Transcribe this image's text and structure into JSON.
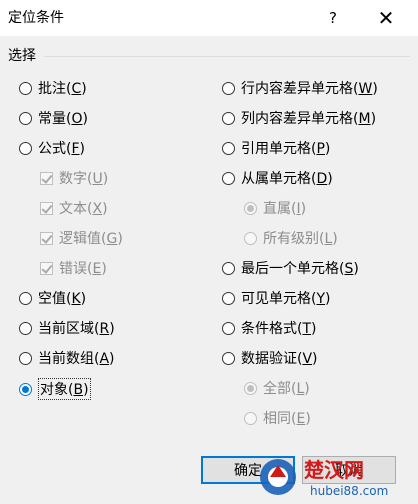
{
  "window": {
    "title": "定位条件",
    "help_label": "?",
    "close_label": "✕"
  },
  "group": {
    "label": "选择"
  },
  "left_options": [
    {
      "text": "批注",
      "key": "C"
    },
    {
      "text": "常量",
      "key": "O"
    },
    {
      "text": "公式",
      "key": "F"
    },
    {
      "text": "数字",
      "key": "U"
    },
    {
      "text": "文本",
      "key": "X"
    },
    {
      "text": "逻辑值",
      "key": "G"
    },
    {
      "text": "错误",
      "key": "E"
    },
    {
      "text": "空值",
      "key": "K"
    },
    {
      "text": "当前区域",
      "key": "R"
    },
    {
      "text": "当前数组",
      "key": "A"
    },
    {
      "text": "对象",
      "key": "B"
    }
  ],
  "right_options": [
    {
      "text": "行内容差异单元格",
      "key": "W"
    },
    {
      "text": "列内容差异单元格",
      "key": "M"
    },
    {
      "text": "引用单元格",
      "key": "P"
    },
    {
      "text": "从属单元格",
      "key": "D"
    },
    {
      "text": "直属",
      "key": "I"
    },
    {
      "text": "所有级别",
      "key": "L"
    },
    {
      "text": "最后一个单元格",
      "key": "S"
    },
    {
      "text": "可见单元格",
      "key": "Y"
    },
    {
      "text": "条件格式",
      "key": "T"
    },
    {
      "text": "数据验证",
      "key": "V"
    },
    {
      "text": "全部",
      "key": "L"
    },
    {
      "text": "相同",
      "key": "E"
    }
  ],
  "buttons": {
    "ok": "确定",
    "cancel": "取消"
  },
  "watermark": {
    "text": "楚汉网",
    "url": "hubei88.com"
  },
  "colors": {
    "accent": "#0078d7",
    "watermark_red": "#d11b1b",
    "watermark_blue": "#1a63b8"
  }
}
